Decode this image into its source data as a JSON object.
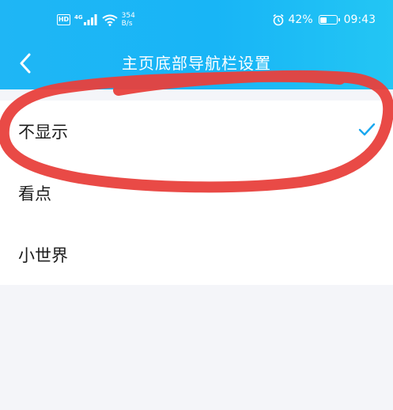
{
  "status_bar": {
    "hd_label": "HD",
    "network_label": "4G",
    "net_speed": "354\nB/s",
    "battery_percent": "42%",
    "battery_level": 0.42,
    "time": "09:43",
    "icons": [
      "hd-icon",
      "signal-icon",
      "wifi-icon",
      "alarm-icon",
      "battery-icon"
    ]
  },
  "nav": {
    "back_icon": "chevron-left-icon",
    "title": "主页底部导航栏设置"
  },
  "options": [
    {
      "label": "不显示",
      "selected": true
    },
    {
      "label": "看点",
      "selected": false
    },
    {
      "label": "小世界",
      "selected": false
    }
  ],
  "colors": {
    "header_blue": "#18b5f6",
    "check_blue": "#1aa8ef",
    "annotation_red": "#e8403c",
    "page_background": "#f4f5f9"
  }
}
